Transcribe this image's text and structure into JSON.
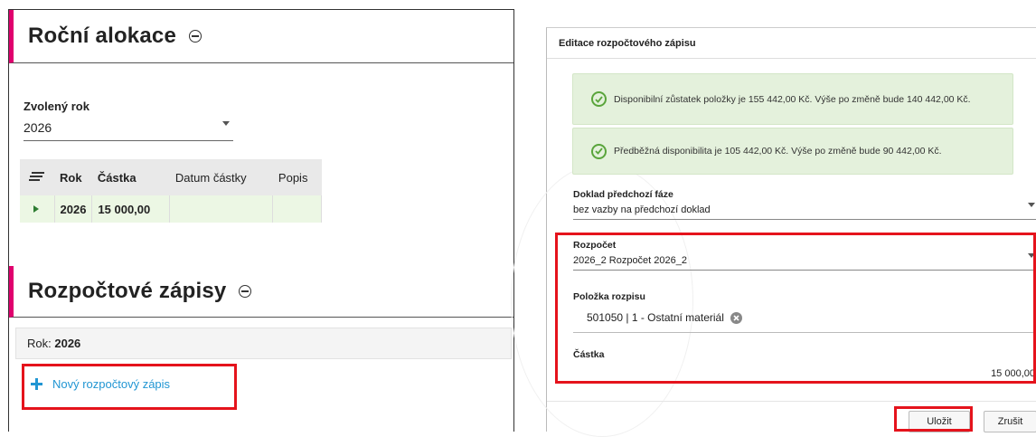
{
  "left": {
    "annual_allocation": {
      "title": "Roční alokace",
      "year_label": "Zvolený rok",
      "year_value": "2026",
      "table": {
        "columns": [
          "Rok",
          "Částka",
          "Datum částky",
          "Popis"
        ],
        "rows": [
          {
            "rok": "2026",
            "castka": "15 000,00",
            "datum": "",
            "popis": ""
          }
        ]
      }
    },
    "budget_entries": {
      "title": "Rozpočtové zápisy",
      "year_prefix": "Rok:",
      "year_value": "2026",
      "new_entry_label": "Nový rozpočtový zápis"
    }
  },
  "dialog": {
    "title": "Editace rozpočtového zápisu",
    "alerts": [
      {
        "text": "Disponibilní zůstatek položky je 155 442,00 Kč. Výše po změně bude 140 442,00 Kč."
      },
      {
        "text": "Předběžná disponibilita je 105 442,00 Kč. Výše po změně bude 90 442,00 Kč."
      }
    ],
    "fields": {
      "previous_doc": {
        "label": "Doklad předchozí fáze",
        "value": "bez vazby na předchozí doklad"
      },
      "budget": {
        "label": "Rozpočet",
        "value": "2026_2 Rozpočet 2026_2"
      },
      "budget_item": {
        "label": "Položka rozpisu",
        "value": "501050 | 1 - Ostatní materiál"
      },
      "amount": {
        "label": "Částka",
        "value": "15 000,00"
      }
    },
    "buttons": {
      "save": "Uložit",
      "cancel": "Zrušit"
    }
  },
  "colors": {
    "accent_magenta": "#e0006e",
    "highlight_red": "#e5131c",
    "link_blue": "#2196d3",
    "alert_green_bg": "#e4f1dc",
    "check_green": "#5aa53c",
    "row_green_bg": "#ecf7e4"
  },
  "icons": [
    "collapse-icon",
    "menu-lines-icon",
    "row-expand-icon",
    "plus-icon",
    "check-circle-icon",
    "clear-icon",
    "dropdown-caret-icon"
  ]
}
